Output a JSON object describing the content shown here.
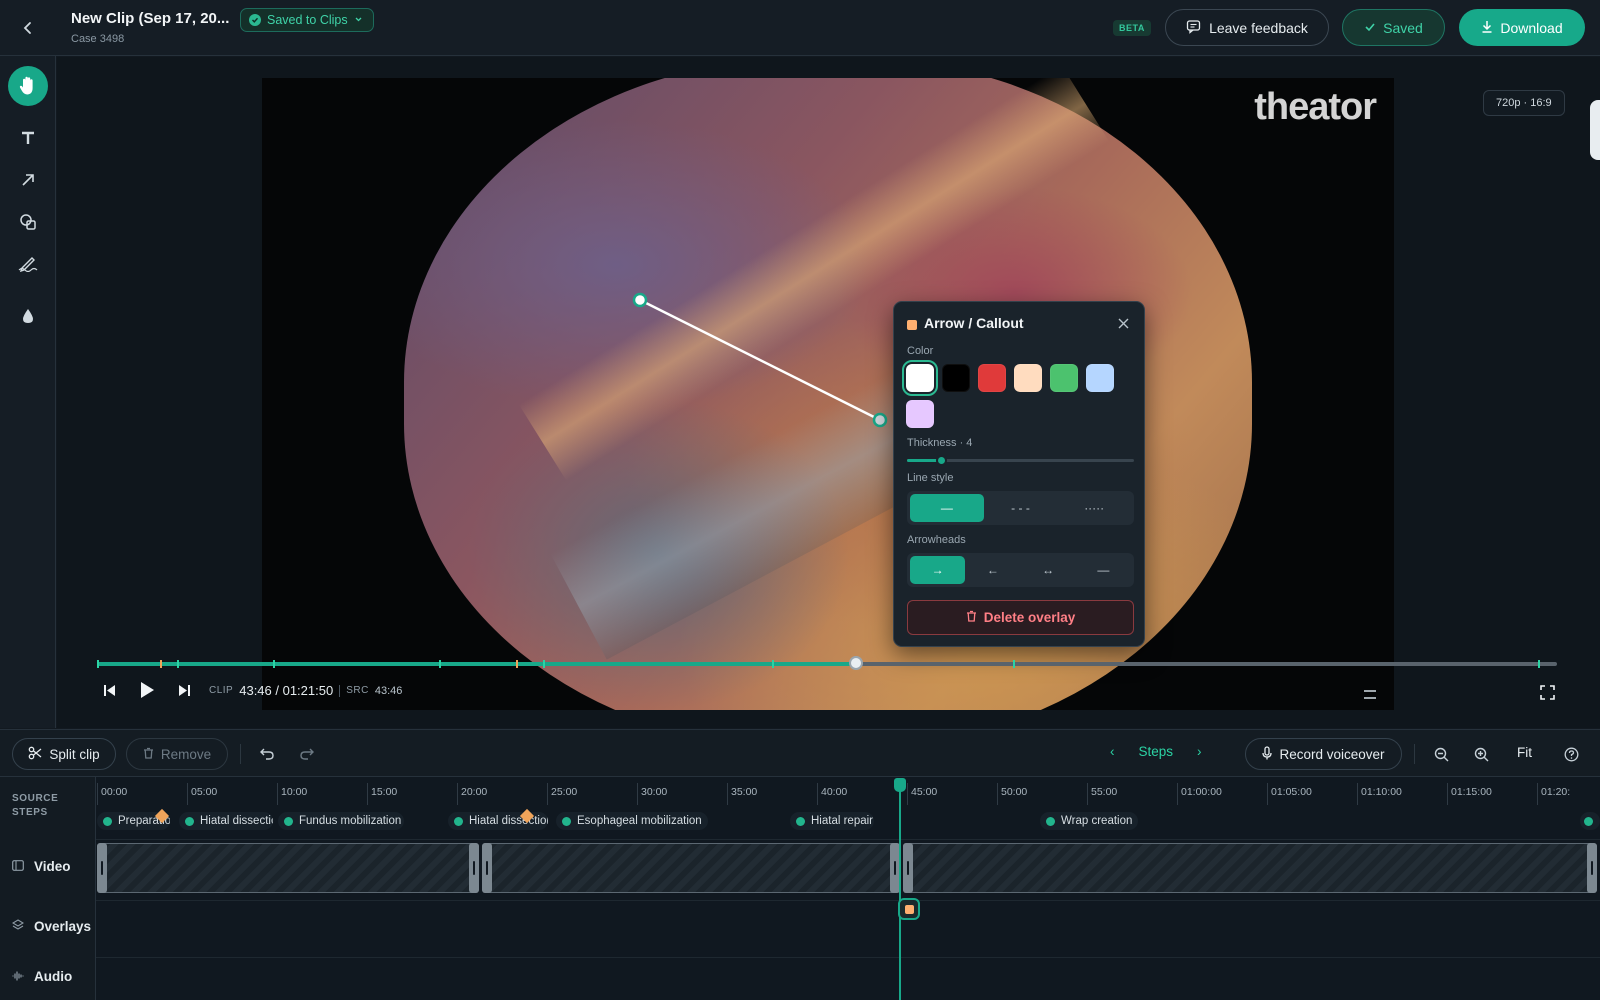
{
  "header": {
    "title": "New Clip (Sep 17, 20...",
    "subtitle": "Case 3498",
    "saved_pill": "Saved to Clips",
    "beta": "BETA",
    "feedback": "Leave feedback",
    "saved": "Saved",
    "download": "Download"
  },
  "tools": [
    "hand-icon",
    "text-icon",
    "arrow-icon",
    "shapes-icon",
    "pen-icon",
    "blur-drop-icon"
  ],
  "video": {
    "watermark": "theator",
    "resolution": "720p · 16:9",
    "progress_fraction": 0.52
  },
  "panel": {
    "title": "Arrow / Callout",
    "color_label": "Color",
    "colors": [
      "#ffffff",
      "#000000",
      "#e03a3a",
      "#ffdcbf",
      "#4cc26e",
      "#b5d6ff",
      "#e6c8ff"
    ],
    "selected_color": "#ffffff",
    "thickness_label": "Thickness · 4",
    "thickness_fraction": 0.15,
    "line_style_label": "Line style",
    "line_styles": [
      "—",
      "- - -",
      "·····"
    ],
    "arrowheads_label": "Arrowheads",
    "arrowheads": [
      "→",
      "←",
      "↔",
      "—"
    ],
    "delete": "Delete overlay"
  },
  "playback": {
    "clip_label": "CLIP",
    "clip_time": "43:46 / 01:21:50",
    "src_label": "SRC",
    "src_time": "43:46"
  },
  "timeline_toolbar": {
    "split": "Split clip",
    "remove": "Remove",
    "steps": "Steps",
    "record": "Record voiceover",
    "fit": "Fit"
  },
  "tracks": {
    "source_steps_1": "SOURCE",
    "source_steps_2": "STEPS",
    "video": "Video",
    "overlays": "Overlays",
    "audio": "Audio"
  },
  "ruler": [
    "00:00",
    "05:00",
    "10:00",
    "15:00",
    "20:00",
    "25:00",
    "30:00",
    "35:00",
    "40:00",
    "45:00",
    "50:00",
    "55:00",
    "01:00:00",
    "01:05:00",
    "01:10:00",
    "01:15:00",
    "01:20:"
  ],
  "steps": [
    "Preparation",
    "Hiatal dissectio",
    "Fundus mobilization",
    "Hiatal dissection",
    "Esophageal mobilization",
    "Hiatal repair",
    "Wrap creation"
  ]
}
